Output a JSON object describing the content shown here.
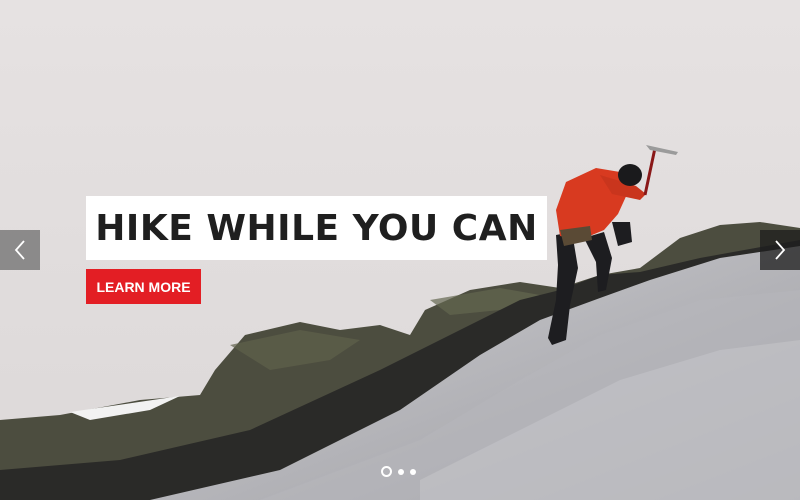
{
  "hero": {
    "headline": "HIKE WHILE YOU CAN",
    "cta_label": "LEARN MORE",
    "cta_color": "#e31e24",
    "background_image": "ice-climber-on-glacier"
  },
  "navigation": {
    "prev_icon": "chevron-left-icon",
    "next_icon": "chevron-right-icon"
  },
  "pagination": {
    "total": 3,
    "active_index": 0
  }
}
